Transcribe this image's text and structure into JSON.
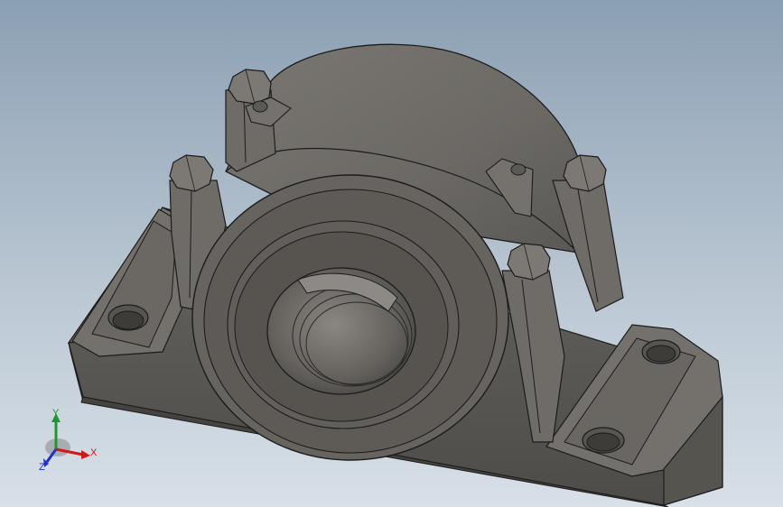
{
  "viewport": {
    "background_top": "#8b9fb3",
    "background_bottom": "#d8e0e8",
    "model_color": "#6e6c69"
  },
  "triad": {
    "x_label": "X",
    "y_label": "Y",
    "z_label": "Z",
    "x_color": "#d01818",
    "y_color": "#1a9a2a",
    "z_color": "#2030c8"
  }
}
